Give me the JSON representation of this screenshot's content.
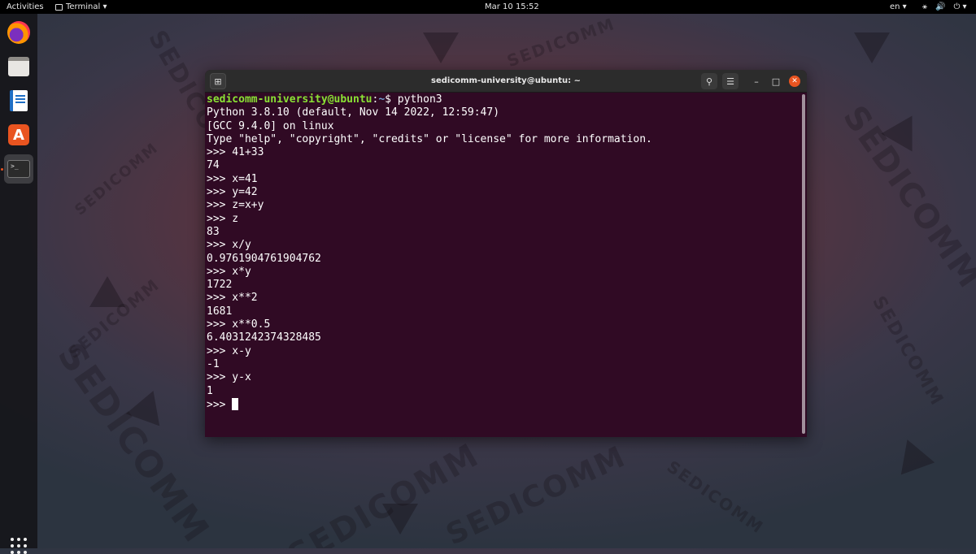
{
  "topbar": {
    "activities": "Activities",
    "app_name": "Terminal ▾",
    "clock": "Mar 10  15:52",
    "language": "en ▾",
    "network_glyph": "⚹",
    "volume_glyph": "🔊",
    "power_glyph": "⏻ ▾"
  },
  "wallpaper": {
    "brand": "SEDICOMM"
  },
  "dock": {
    "terminal_glyph": ">_",
    "store_glyph": "A",
    "items": [
      "firefox-icon",
      "files-icon",
      "writer-icon",
      "software-store-icon",
      "terminal-icon"
    ]
  },
  "window": {
    "title": "sedicomm-university@ubuntu: ~",
    "new_tab_glyph": "⊞",
    "search_glyph": "⚲",
    "menu_glyph": "☰",
    "minimize_glyph": "–",
    "maximize_glyph": "□",
    "close_glyph": "✕"
  },
  "terminal": {
    "prompt_user": "sedicomm-university@ubuntu",
    "prompt_sep": ":",
    "prompt_path": "~",
    "prompt_cmd": "$ python3",
    "lines": [
      "Python 3.8.10 (default, Nov 14 2022, 12:59:47)",
      "[GCC 9.4.0] on linux",
      "Type \"help\", \"copyright\", \"credits\" or \"license\" for more information.",
      ">>> 41+33",
      "74",
      ">>> x=41",
      ">>> y=42",
      ">>> z=x+y",
      ">>> z",
      "83",
      ">>> x/y",
      "0.9761904761904762",
      ">>> x*y",
      "1722",
      ">>> x**2",
      "1681",
      ">>> x**0.5",
      "6.4031242374328485",
      ">>> x-y",
      "-1",
      ">>> y-x",
      "1"
    ],
    "final_prompt": ">>> "
  },
  "colors": {
    "terminal_bg": "#300a24",
    "prompt_user": "#8ae234",
    "prompt_path": "#729fcf",
    "close_button": "#e95420"
  }
}
